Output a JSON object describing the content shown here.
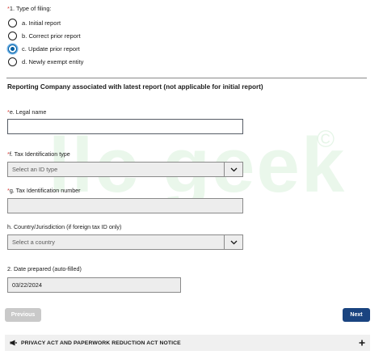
{
  "watermark": {
    "text": "llc geek",
    "symbol": "©"
  },
  "filing": {
    "required_mark": "*",
    "label": "1. Type of filing:",
    "options": [
      {
        "label": "a. Initial report",
        "checked": false
      },
      {
        "label": "b. Correct prior report",
        "checked": false
      },
      {
        "label": "c. Update prior report",
        "checked": true
      },
      {
        "label": "d. Newly exempt entity",
        "checked": false
      }
    ]
  },
  "reporting_company": {
    "section_title": "Reporting Company associated with latest report (not applicable for initial report)",
    "legal_name": {
      "required_mark": "*",
      "label": "e. Legal name",
      "value": ""
    },
    "tax_id_type": {
      "required_mark": "*",
      "label": "f. Tax Identification type",
      "placeholder": "Select an ID type"
    },
    "tax_id_number": {
      "required_mark": "*",
      "label": "g. Tax Identification number",
      "value": ""
    },
    "country": {
      "label": "h. Country/Jurisdiction (if foreign tax ID only)",
      "placeholder": "Select a country"
    },
    "date_prepared": {
      "label": "2. Date prepared (auto-filled)",
      "value": "03/22/2024"
    }
  },
  "nav": {
    "previous_label": "Previous",
    "next_label": "Next"
  },
  "accordion": {
    "title": "PRIVACY ACT AND PAPERWORK REDUCTION ACT NOTICE",
    "icon": "megaphone-icon",
    "toggle": "plus-icon"
  },
  "colors": {
    "primary": "#1a4480",
    "selected_radio": "#005ea2",
    "required": "#d83933",
    "watermark": "#39b54a"
  }
}
